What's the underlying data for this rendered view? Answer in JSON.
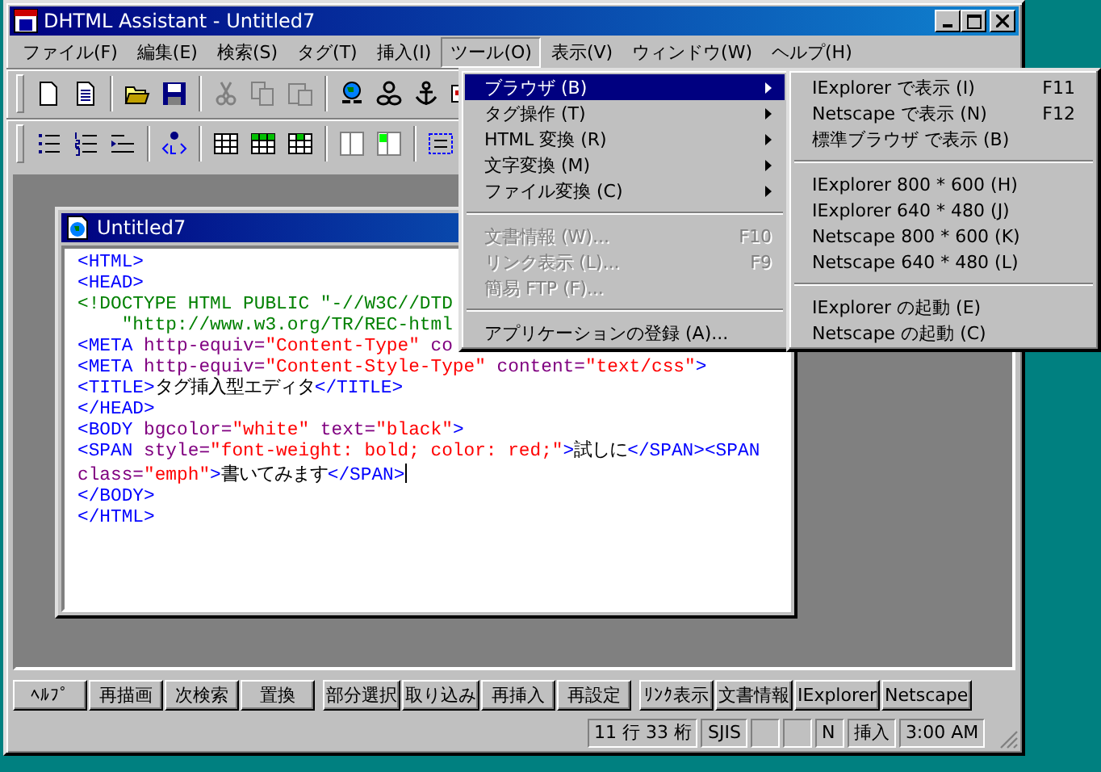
{
  "window": {
    "title": "DHTML Assistant - Untitled7"
  },
  "menubar": [
    {
      "label": "ファイル(F)",
      "selected": false
    },
    {
      "label": "編集(E)",
      "selected": false
    },
    {
      "label": "検索(S)",
      "selected": false
    },
    {
      "label": "タグ(T)",
      "selected": false
    },
    {
      "label": "挿入(I)",
      "selected": false
    },
    {
      "label": "ツール(O)",
      "selected": true
    },
    {
      "label": "表示(V)",
      "selected": false
    },
    {
      "label": "ウィンドウ(W)",
      "selected": false
    },
    {
      "label": "ヘルプ(H)",
      "selected": false
    }
  ],
  "tools_menu": [
    {
      "kind": "submenu",
      "label": "ブラウザ (B)",
      "selected": true,
      "disabled": false
    },
    {
      "kind": "submenu",
      "label": "タグ操作 (T)",
      "selected": false,
      "disabled": false
    },
    {
      "kind": "submenu",
      "label": "HTML 変換 (R)",
      "selected": false,
      "disabled": false
    },
    {
      "kind": "submenu",
      "label": "文字変換 (M)",
      "selected": false,
      "disabled": false
    },
    {
      "kind": "submenu",
      "label": "ファイル変換 (C)",
      "selected": false,
      "disabled": false
    },
    {
      "kind": "separator"
    },
    {
      "kind": "item",
      "label": "文書情報 (W)...",
      "shortcut": "F10",
      "selected": false,
      "disabled": true
    },
    {
      "kind": "item",
      "label": "リンク表示 (L)...",
      "shortcut": "F9",
      "selected": false,
      "disabled": true
    },
    {
      "kind": "item",
      "label": "簡易 FTP (F)...",
      "selected": false,
      "disabled": true
    },
    {
      "kind": "separator"
    },
    {
      "kind": "item",
      "label": "アプリケーションの登録 (A)...",
      "selected": false,
      "disabled": false
    }
  ],
  "browser_submenu": [
    {
      "kind": "item",
      "label": "IExplorer で表示 (I)",
      "shortcut": "F11"
    },
    {
      "kind": "item",
      "label": "Netscape で表示 (N)",
      "shortcut": "F12"
    },
    {
      "kind": "item",
      "label": "標準ブラウザ で表示 (B)"
    },
    {
      "kind": "separator"
    },
    {
      "kind": "item",
      "label": "IExplorer 800 * 600 (H)"
    },
    {
      "kind": "item",
      "label": "IExplorer 640 * 480 (J)"
    },
    {
      "kind": "item",
      "label": "Netscape 800 * 600 (K)"
    },
    {
      "kind": "item",
      "label": "Netscape 640 * 480 (L)"
    },
    {
      "kind": "separator"
    },
    {
      "kind": "item",
      "label": "IExplorer の起動 (E)"
    },
    {
      "kind": "item",
      "label": "Netscape の起動 (C)"
    }
  ],
  "document": {
    "title": "Untitled7",
    "lines": [
      {
        "caret": false,
        "segments": [
          {
            "kind": "tag",
            "text": "<HTML>"
          }
        ]
      },
      {
        "caret": false,
        "segments": [
          {
            "kind": "tag",
            "text": "<HEAD>"
          }
        ]
      },
      {
        "caret": false,
        "segments": [
          {
            "kind": "doctype",
            "text": "<!DOCTYPE HTML PUBLIC \"-//W3C//DTD"
          }
        ]
      },
      {
        "caret": false,
        "segments": [
          {
            "kind": "doctype",
            "text": "    \"http://www.w3.org/TR/REC-html"
          }
        ]
      },
      {
        "caret": false,
        "segments": [
          {
            "kind": "tag",
            "text": "<META "
          },
          {
            "kind": "attr",
            "text": "http-equiv="
          },
          {
            "kind": "value",
            "text": "\"Content-Type\""
          },
          {
            "kind": "attr",
            "text": " co"
          }
        ]
      },
      {
        "caret": false,
        "segments": [
          {
            "kind": "tag",
            "text": "<META "
          },
          {
            "kind": "attr",
            "text": "http-equiv="
          },
          {
            "kind": "value",
            "text": "\"Content-Style-Type\""
          },
          {
            "kind": "attr",
            "text": " content="
          },
          {
            "kind": "value",
            "text": "\"text/css\""
          },
          {
            "kind": "tag",
            "text": ">"
          }
        ]
      },
      {
        "caret": false,
        "segments": [
          {
            "kind": "tag",
            "text": "<TITLE>"
          },
          {
            "kind": "text",
            "text": "タグ挿入型エディタ"
          },
          {
            "kind": "tag",
            "text": "</TITLE>"
          }
        ]
      },
      {
        "caret": false,
        "segments": [
          {
            "kind": "tag",
            "text": "</HEAD>"
          }
        ]
      },
      {
        "caret": false,
        "segments": [
          {
            "kind": "tag",
            "text": "<BODY "
          },
          {
            "kind": "attr",
            "text": "bgcolor="
          },
          {
            "kind": "value",
            "text": "\"white\""
          },
          {
            "kind": "attr",
            "text": " text="
          },
          {
            "kind": "value",
            "text": "\"black\""
          },
          {
            "kind": "tag",
            "text": ">"
          }
        ]
      },
      {
        "caret": false,
        "segments": [
          {
            "kind": "tag",
            "text": "<SPAN "
          },
          {
            "kind": "attr",
            "text": "style="
          },
          {
            "kind": "value",
            "text": "\"font-weight: bold; color: red;\""
          },
          {
            "kind": "tag",
            "text": ">"
          },
          {
            "kind": "text",
            "text": "試しに"
          },
          {
            "kind": "tag",
            "text": "</SPAN><SPAN"
          }
        ]
      },
      {
        "caret": true,
        "segments": [
          {
            "kind": "attr",
            "text": "class="
          },
          {
            "kind": "value",
            "text": "\"emph\""
          },
          {
            "kind": "tag",
            "text": ">"
          },
          {
            "kind": "text",
            "text": "書いてみます"
          },
          {
            "kind": "tag",
            "text": "</SPAN>"
          }
        ]
      },
      {
        "caret": false,
        "segments": [
          {
            "kind": "tag",
            "text": "</BODY>"
          }
        ]
      },
      {
        "caret": false,
        "segments": [
          {
            "kind": "tag",
            "text": "</HTML>"
          }
        ]
      }
    ]
  },
  "function_keys": [
    [
      "ﾍﾙﾌﾟ",
      "再描画",
      "次検索",
      "置換"
    ],
    [
      "部分選択",
      "取り込み",
      "再挿入",
      "再設定"
    ],
    [
      "ﾘﾝｸ表示",
      "文書情報",
      "IExplorer",
      "Netscape"
    ]
  ],
  "status_bar": [
    {
      "kind": "text",
      "text": "11 行 33 桁"
    },
    {
      "kind": "text",
      "text": "SJIS"
    },
    {
      "kind": "blank"
    },
    {
      "kind": "blank"
    },
    {
      "kind": "text",
      "text": "N"
    },
    {
      "kind": "text",
      "text": "挿入"
    },
    {
      "kind": "text",
      "text": "3:00 AM"
    }
  ]
}
